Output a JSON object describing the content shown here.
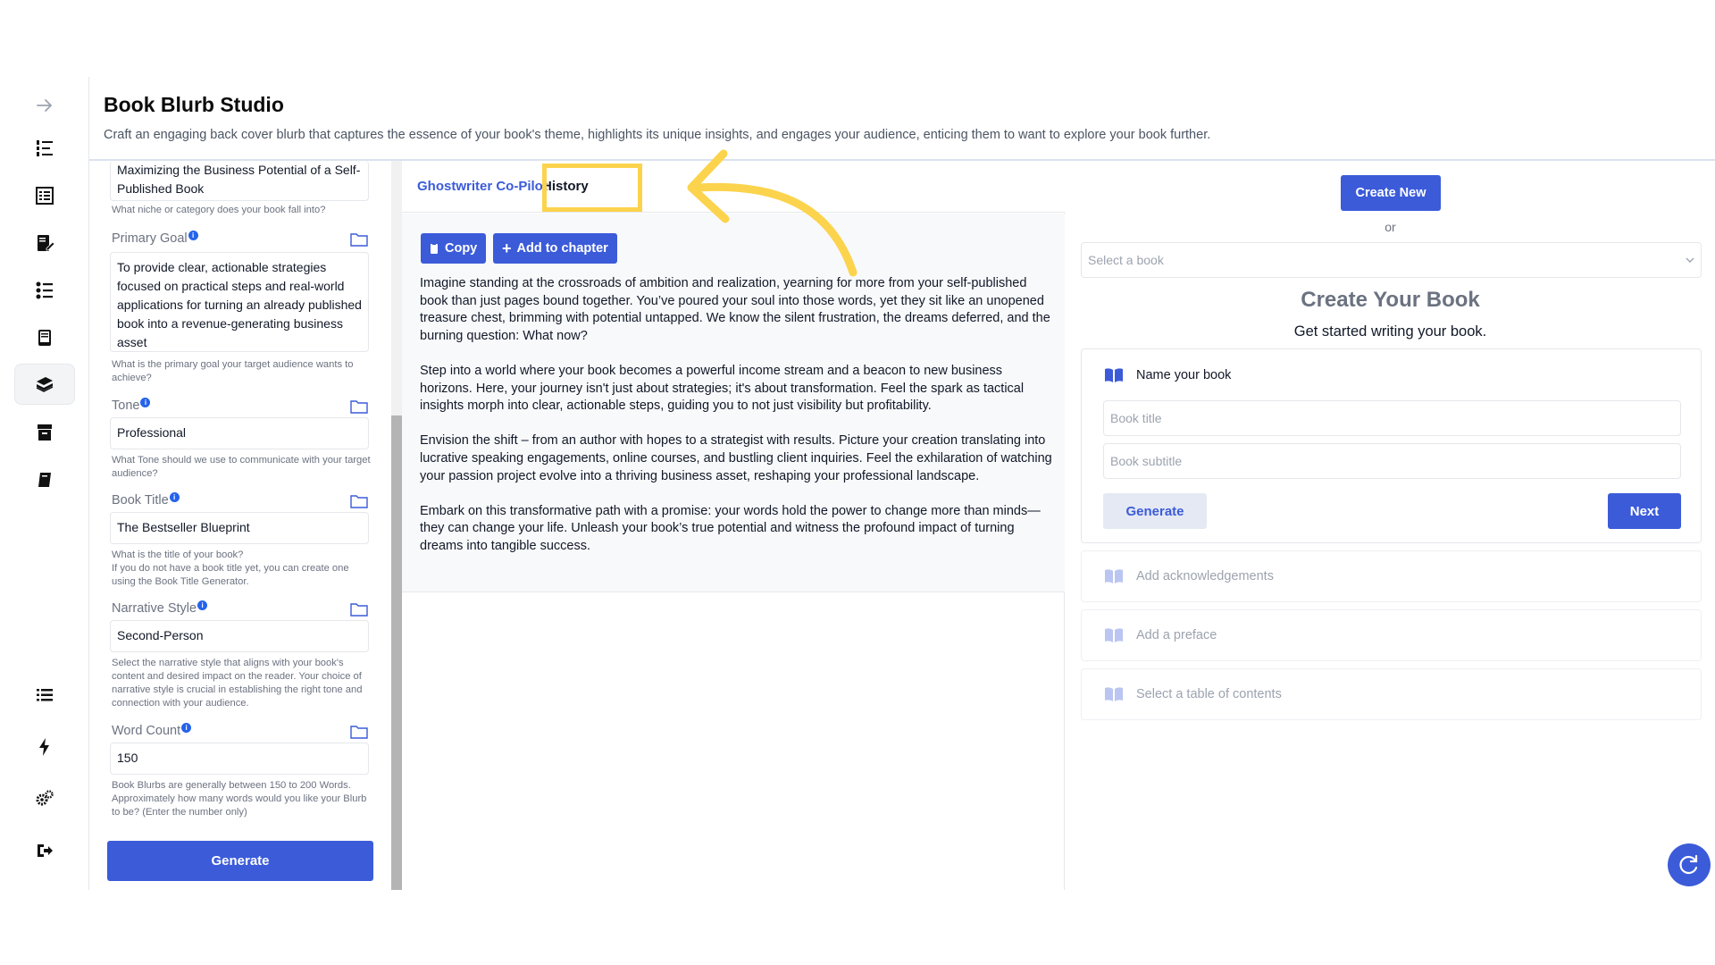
{
  "app": {
    "title": "Book Blurb Studio",
    "subtitle": "Craft an engaging back cover blurb that captures the essence of your book's theme, highlights its unique insights, and engages your audience, enticing them to want to explore your book further."
  },
  "rail": {
    "items": [
      {
        "icon": "arrow-right-icon"
      },
      {
        "icon": "numbered-list-icon"
      },
      {
        "icon": "ledger-icon"
      },
      {
        "icon": "edit-book-icon"
      },
      {
        "icon": "checklist-icon"
      },
      {
        "icon": "book-device-icon"
      },
      {
        "icon": "books-stack-icon",
        "active": true
      },
      {
        "icon": "archive-icon"
      },
      {
        "icon": "notebook-icon"
      },
      {
        "icon": "list-icon"
      },
      {
        "icon": "bolt-icon"
      },
      {
        "icon": "gears-icon"
      },
      {
        "icon": "logout-icon"
      }
    ]
  },
  "form": {
    "niche_value": "Maximizing the Business Potential of a Self-Published Book",
    "niche_help": "What niche or category does your book fall into?",
    "primary_goal_label": "Primary Goal",
    "primary_goal_value": "To provide clear, actionable strategies focused on practical steps and real-world applications for turning an already published book into a revenue-generating business asset",
    "primary_goal_help": "What is the primary goal your target audience wants to achieve?",
    "tone_label": "Tone",
    "tone_value": "Professional",
    "tone_help": "What Tone should we use to communicate with your target audience?",
    "book_title_label": "Book Title",
    "book_title_value": "The Bestseller Blueprint",
    "book_title_help": "What is the title of your book?\nIf you do not have a book title yet, you can create one using the Book Title Generator.",
    "narrative_label": "Narrative Style",
    "narrative_value": "Second-Person",
    "narrative_help": "Select the narrative style that aligns with your book's content and desired impact on the reader. Your choice of narrative style is crucial in establishing the right tone and connection with your audience.",
    "word_count_label": "Word Count",
    "word_count_value": "150",
    "word_count_help": "Book Blurbs are generally between 150 to 200 Words. Approximately how many words would you like your Blurb to be? (Enter the number only)",
    "generate_label": "Generate"
  },
  "middle": {
    "tab_copilot": "Ghostwriter Co-Pilot",
    "tab_history": "History",
    "copy_label": "Copy",
    "add_chapter_label": "Add to chapter",
    "paragraphs": [
      "Imagine standing at the crossroads of ambition and realization, yearning for more from your self-published book than just pages bound together. You’ve poured your soul into those words, yet they sit like an unopened treasure chest, brimming with potential untapped. We know the silent frustration, the dreams deferred, and the burning question: What now?",
      "Step into a world where your book becomes a powerful income stream and a beacon to new business horizons. Here, your journey isn't just about strategies; it's about transformation. Feel the spark as tactical insights morph into clear, actionable steps, guiding you to not just visibility but profitability.",
      "Envision the shift – from an author with hopes to a strategist with results. Picture your creation translating into lucrative speaking engagements, online courses, and bustling client inquiries. Feel the exhilaration of watching your passion project evolve into a thriving business asset, reshaping your professional landscape.",
      "Embark on this transformative path with a promise: your words hold the power to change more than minds—they can change your life. Unleash your book’s true potential and witness the profound impact of turning dreams into tangible success."
    ]
  },
  "right": {
    "create_new_label": "Create New",
    "or_label": "or",
    "select_book_placeholder": "Select a book",
    "create_title": "Create Your Book",
    "create_subtitle": "Get started writing your book.",
    "name_book_label": "Name your book",
    "book_title_placeholder": "Book title",
    "book_subtitle_placeholder": "Book subtitle",
    "generate_label": "Generate",
    "next_label": "Next",
    "steps": [
      "Add acknowledgements",
      "Add a preface",
      "Select a table of contents"
    ]
  },
  "colors": {
    "accent": "#3b5bd9",
    "highlight": "#fcd34d"
  }
}
